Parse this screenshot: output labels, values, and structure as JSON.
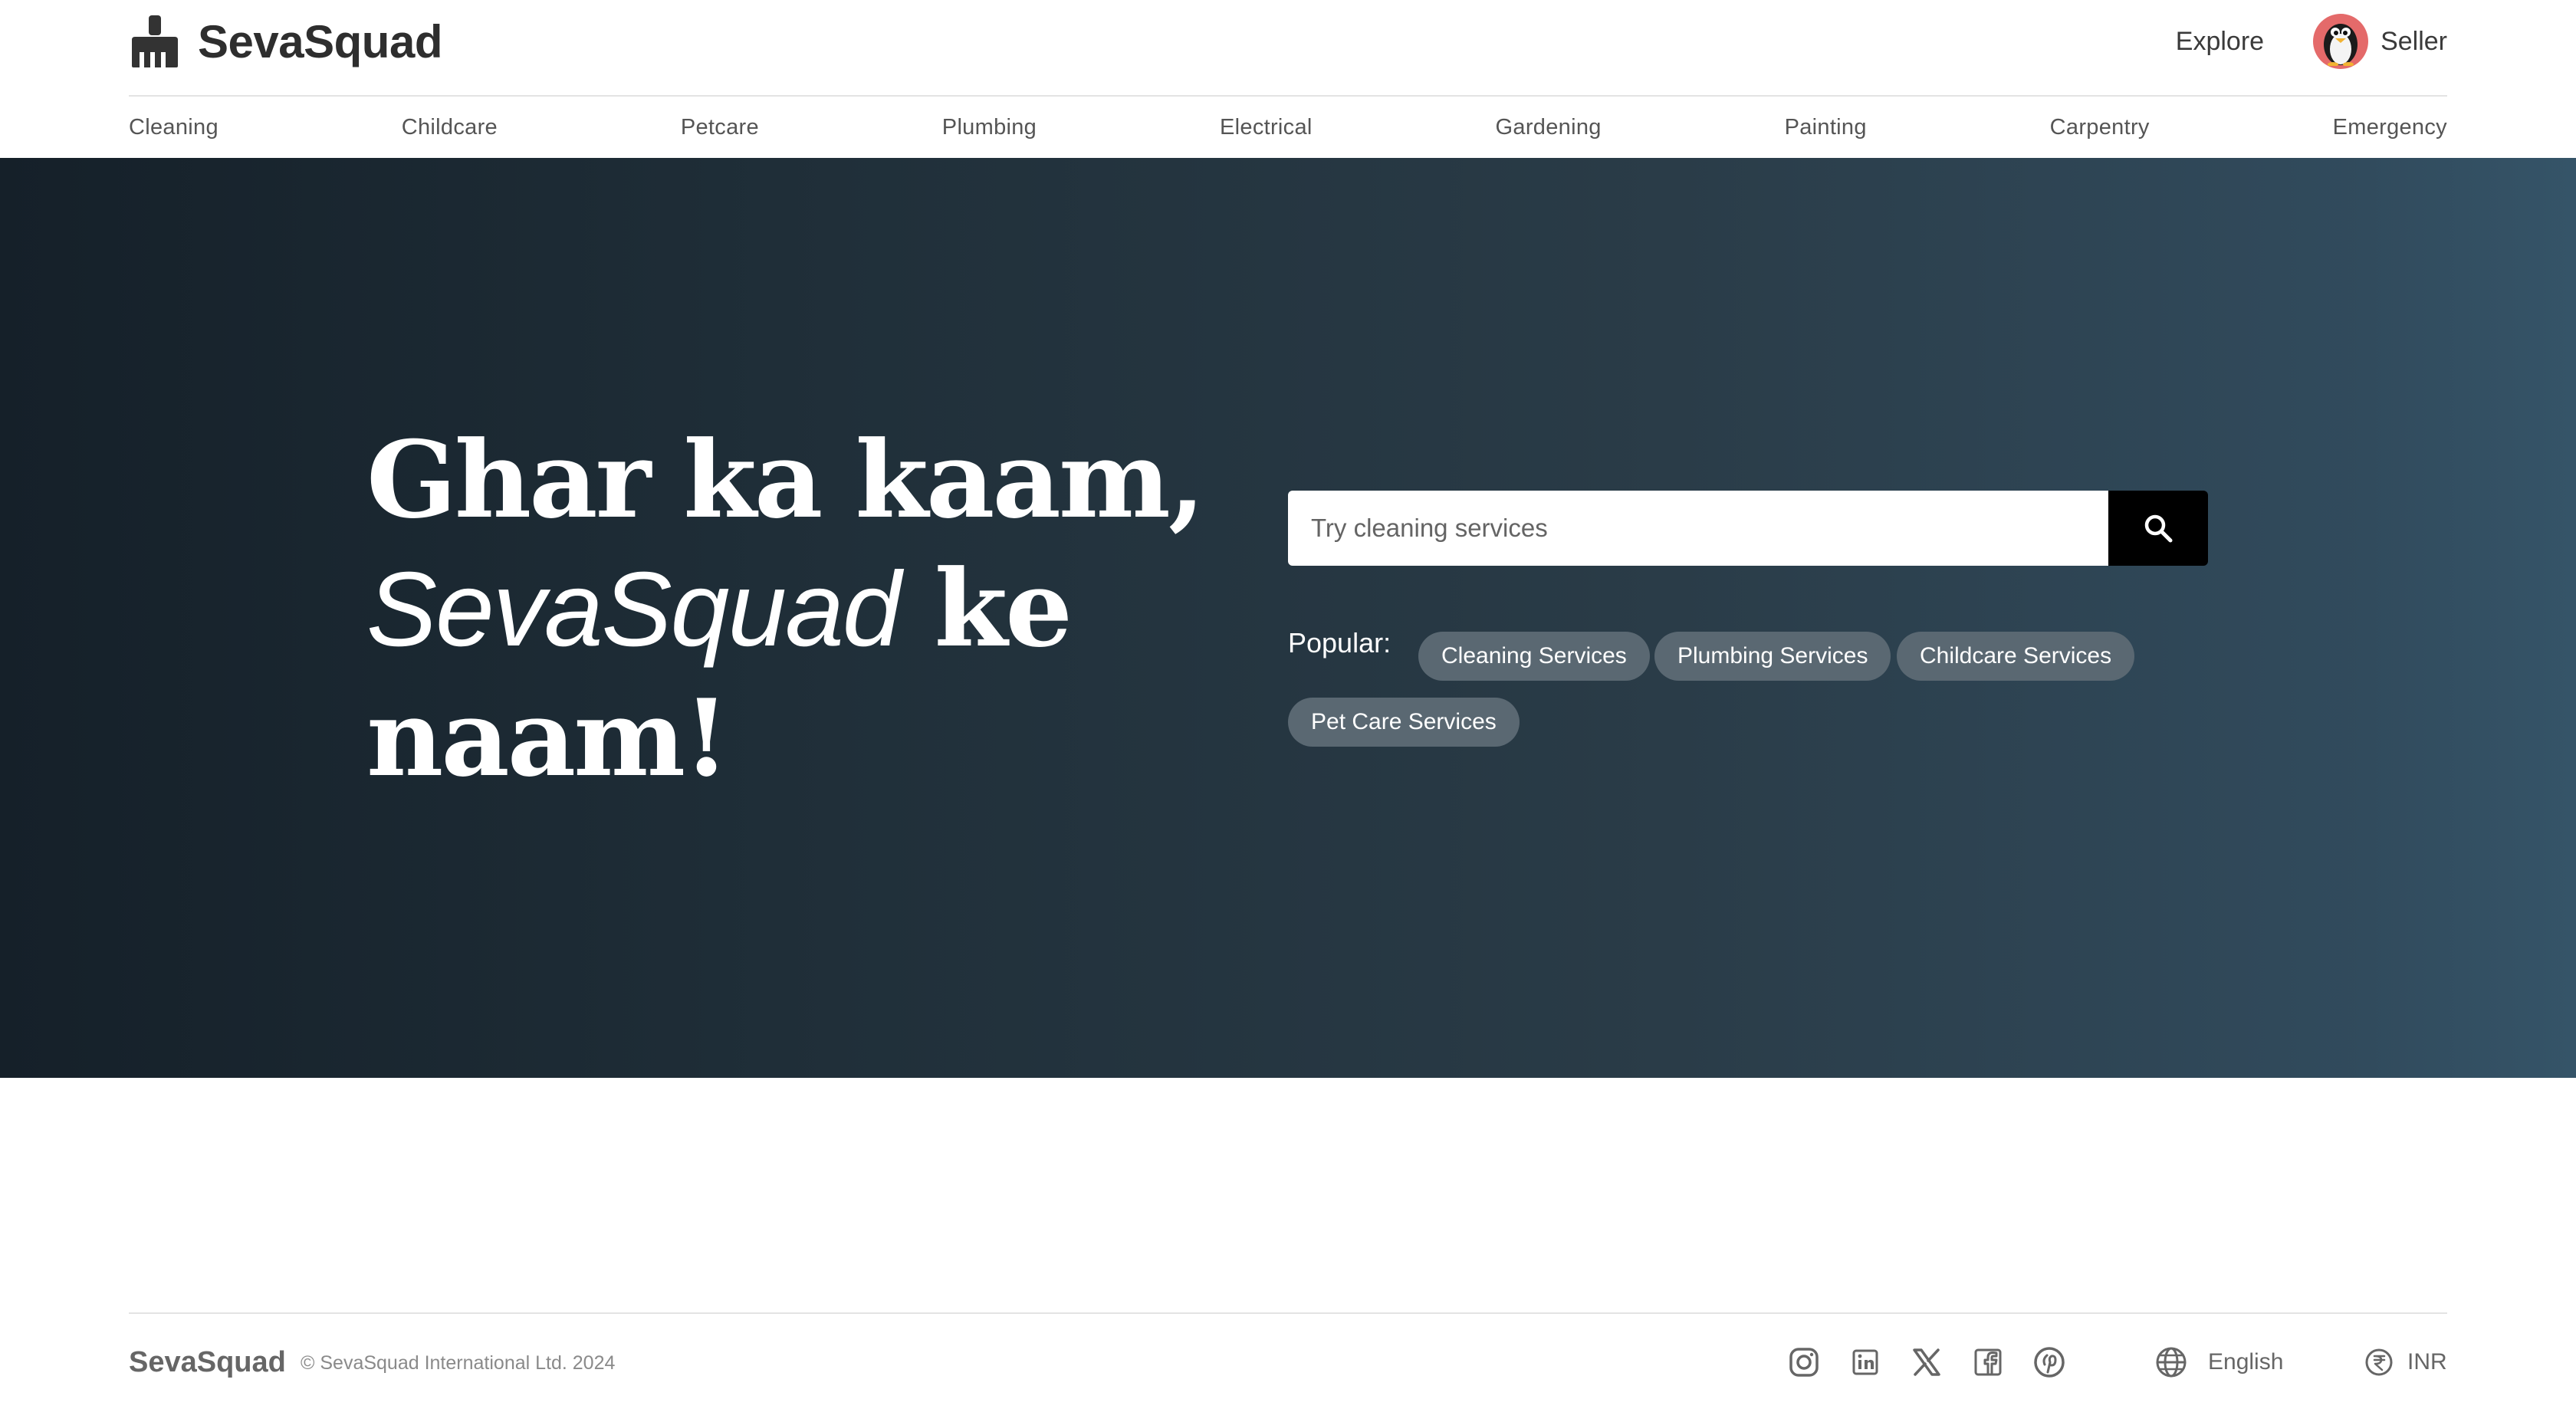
{
  "header": {
    "brand": "SevaSquad",
    "brand_icon": "broom-icon",
    "explore": "Explore",
    "seller": "Seller",
    "avatar_icon": "penguin-avatar"
  },
  "categories": [
    "Cleaning",
    "Childcare",
    "Petcare",
    "Plumbing",
    "Electrical",
    "Gardening",
    "Painting",
    "Carpentry",
    "Emergency"
  ],
  "hero": {
    "line1": "Ghar ka kaam,",
    "line2_brand": "SevaSquad",
    "line2_rest": " ke",
    "line3": "naam!",
    "search_placeholder": "Try cleaning services",
    "search_icon": "search-icon",
    "popular_label": "Popular:",
    "popular": [
      "Cleaning Services",
      "Plumbing Services",
      "Childcare Services",
      "Pet Care Services"
    ]
  },
  "footer": {
    "brand": "SevaSquad",
    "copyright": "© SevaSquad International Ltd. 2024",
    "social_icons": [
      "instagram-icon",
      "linkedin-icon",
      "x-icon",
      "facebook-icon",
      "pinterest-icon"
    ],
    "language": "English",
    "currency": "INR"
  },
  "colors": {
    "hero_gradient_start": "#152029",
    "hero_gradient_end": "#355468",
    "chip_bg": "#5a6872",
    "search_button": "#000000",
    "avatar_bg": "#e46a6a"
  }
}
